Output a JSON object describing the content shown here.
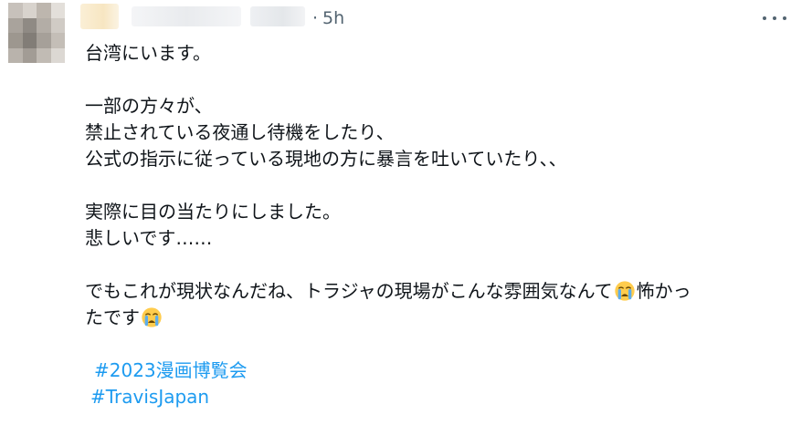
{
  "tweet": {
    "time_separator": "·",
    "time_ago": "5h",
    "lines": [
      "台湾にいます。",
      "",
      "一部の方々が、",
      "禁止されている夜通し待機をしたり、",
      "公式の指示に従っている現地の方に暴言を吐いていたり、、",
      "",
      "実際に目の当たりにしました。",
      "悲しいです……",
      "",
      "でもこれが現状なんだね、トラジャの現場がこんな雰囲気なんて",
      "怖かっ",
      "たです"
    ],
    "hashtags": [
      "#2023漫画博覧会",
      "#TravisJapan"
    ],
    "icons": {
      "more": "more-horizontal-icon",
      "emoji": "loudly-crying-face-emoji"
    },
    "colors": {
      "text": "#0f1419",
      "muted": "#536471",
      "link": "#1d9bf0",
      "background": "#ffffff"
    }
  }
}
